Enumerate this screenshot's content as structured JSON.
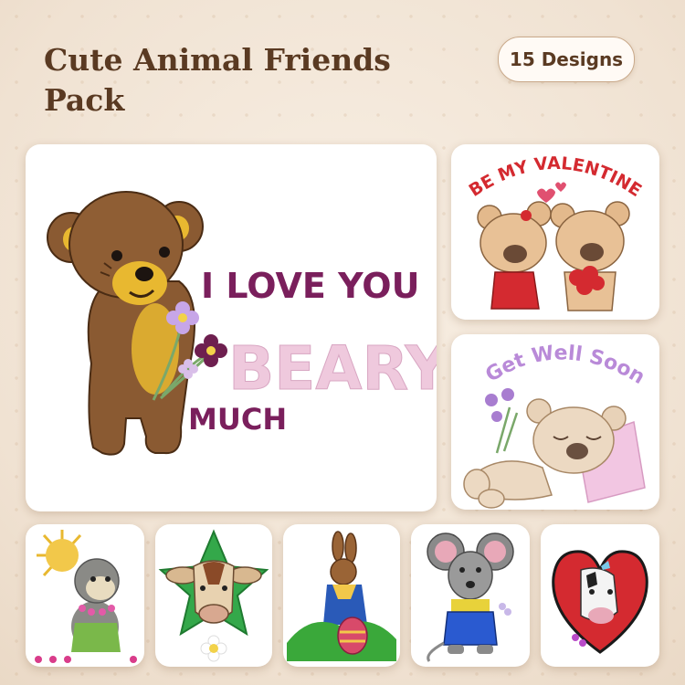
{
  "header": {
    "title": "Cute Animal Friends Pack",
    "badge": "15 Designs"
  },
  "hero": {
    "line1": "I LOVE YOU",
    "line2": "BEARY",
    "line3": "MUCH"
  },
  "valentine": {
    "text": "BE MY VALENTINE"
  },
  "get_well": {
    "text": "Get Well Soon"
  },
  "palette": {
    "bear_brown": "#8a5a32",
    "bear_light": "#e8c196",
    "plum": "#7a1f5c",
    "pink_text": "#efc9dd",
    "red": "#d42a30",
    "lilac": "#b98ad8"
  }
}
